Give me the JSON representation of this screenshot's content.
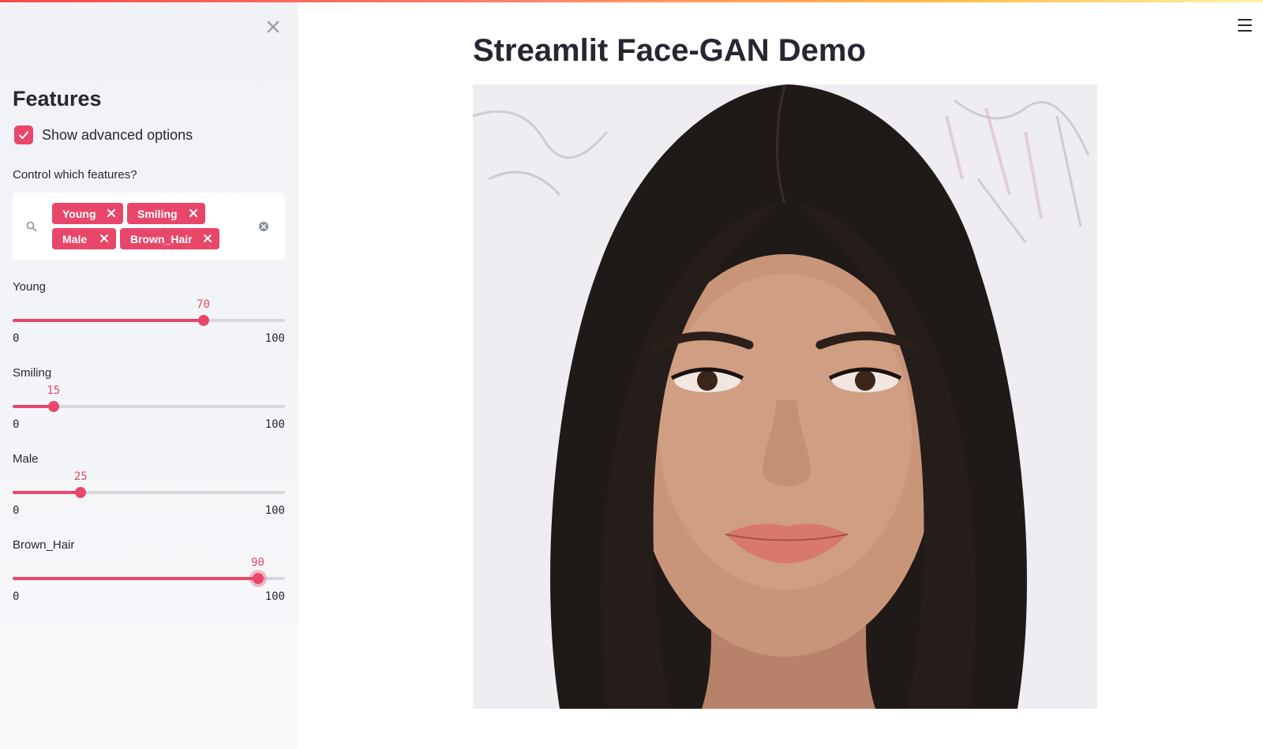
{
  "sidebar": {
    "title": "Features",
    "advanced_checkbox": {
      "label": "Show advanced options",
      "checked": true
    },
    "multiselect": {
      "label": "Control which features?",
      "selected": [
        "Young",
        "Smiling",
        "Male",
        "Brown_Hair"
      ]
    },
    "sliders": [
      {
        "label": "Young",
        "value": "70",
        "min": "0",
        "max": "100"
      },
      {
        "label": "Smiling",
        "value": "15",
        "min": "0",
        "max": "100"
      },
      {
        "label": "Male",
        "value": "25",
        "min": "0",
        "max": "100"
      },
      {
        "label": "Brown_Hair",
        "value": "90",
        "min": "0",
        "max": "100"
      }
    ]
  },
  "main": {
    "title": "Streamlit Face-GAN Demo",
    "image_content": "generated face portrait"
  },
  "colors": {
    "accent": "#e8476a",
    "sidebar_bg": "#f0f2f6",
    "text": "#262730"
  },
  "icons": {
    "close": "close-icon",
    "menu": "hamburger-menu-icon",
    "search": "search-icon",
    "clear": "clear-all-icon",
    "tag_remove": "tag-remove-icon",
    "check": "checkmark-icon"
  }
}
